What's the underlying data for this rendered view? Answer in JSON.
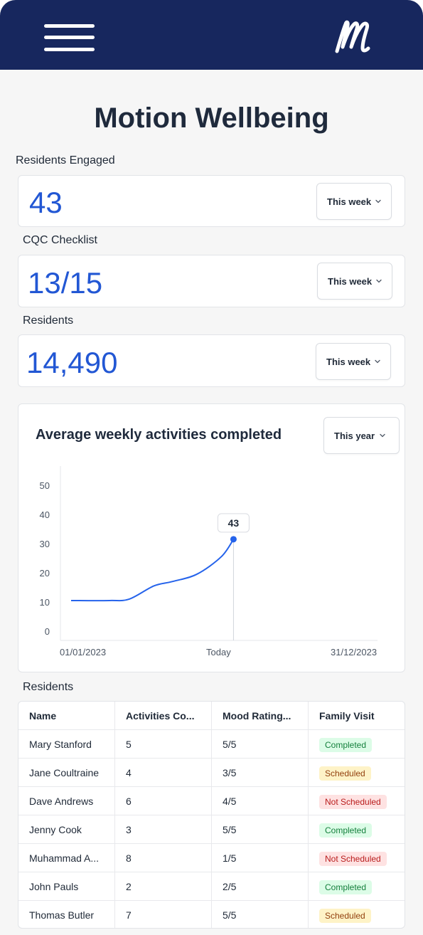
{
  "header": {
    "menu_icon": "hamburger-menu-icon",
    "logo_icon": "motion-m-logo",
    "colors": {
      "navbar": "#17275e",
      "accent": "#2257d4"
    }
  },
  "page": {
    "title": "Motion Wellbeing"
  },
  "metrics": [
    {
      "label": "Residents Engaged",
      "value": "43",
      "period": "This week"
    },
    {
      "label": "CQC Checklist",
      "value": "13/15",
      "period": "This week"
    },
    {
      "label": "Residents",
      "value": "14,490",
      "period": "This week"
    }
  ],
  "chart": {
    "title": "Average weekly activities completed",
    "period": "This year",
    "tooltip": "43"
  },
  "chart_data": {
    "type": "line",
    "title": "Average weekly activities completed",
    "xlabel": "",
    "ylabel": "",
    "ylim": [
      0,
      50
    ],
    "yticks": [
      "50",
      "40",
      "30",
      "20",
      "10",
      "0"
    ],
    "xticks": [
      "01/01/2023",
      "Today",
      "31/12/2023"
    ],
    "x": [
      0,
      0.125,
      0.19,
      0.27,
      0.33,
      0.41,
      0.49,
      0.53
    ],
    "series": [
      {
        "values": [
          10.5,
          10.5,
          11,
          15.5,
          17,
          19.5,
          25.5,
          31.5
        ]
      }
    ],
    "highlight": {
      "label": "43",
      "x": 0.53,
      "y": 31.5
    },
    "grid": false,
    "color": "#2563eb"
  },
  "table": {
    "section_label": "Residents",
    "headers": [
      "Name",
      "Activities Co...",
      "Mood Rating...",
      "Family Visit"
    ],
    "rows": [
      {
        "name": "Mary Stanford",
        "activities": "5",
        "mood": "5/5",
        "visit": "Completed"
      },
      {
        "name": "Jane Coultraine",
        "activities": "4",
        "mood": "3/5",
        "visit": "Scheduled"
      },
      {
        "name": "Dave Andrews",
        "activities": "6",
        "mood": "4/5",
        "visit": "Not Scheduled"
      },
      {
        "name": "Jenny Cook",
        "activities": "3",
        "mood": "5/5",
        "visit": "Completed"
      },
      {
        "name": "Muhammad A...",
        "activities": "8",
        "mood": "1/5",
        "visit": "Not Scheduled"
      },
      {
        "name": "John Pauls",
        "activities": "2",
        "mood": "2/5",
        "visit": "Completed"
      },
      {
        "name": "Thomas Butler",
        "activities": "7",
        "mood": "5/5",
        "visit": "Scheduled"
      }
    ],
    "badge_colors": {
      "Completed": {
        "bg": "#dcfce7",
        "fg": "#15803d"
      },
      "Scheduled": {
        "bg": "#fef3c7",
        "fg": "#92400e"
      },
      "Not Scheduled": {
        "bg": "#fee2e2",
        "fg": "#b91c1c"
      }
    }
  }
}
